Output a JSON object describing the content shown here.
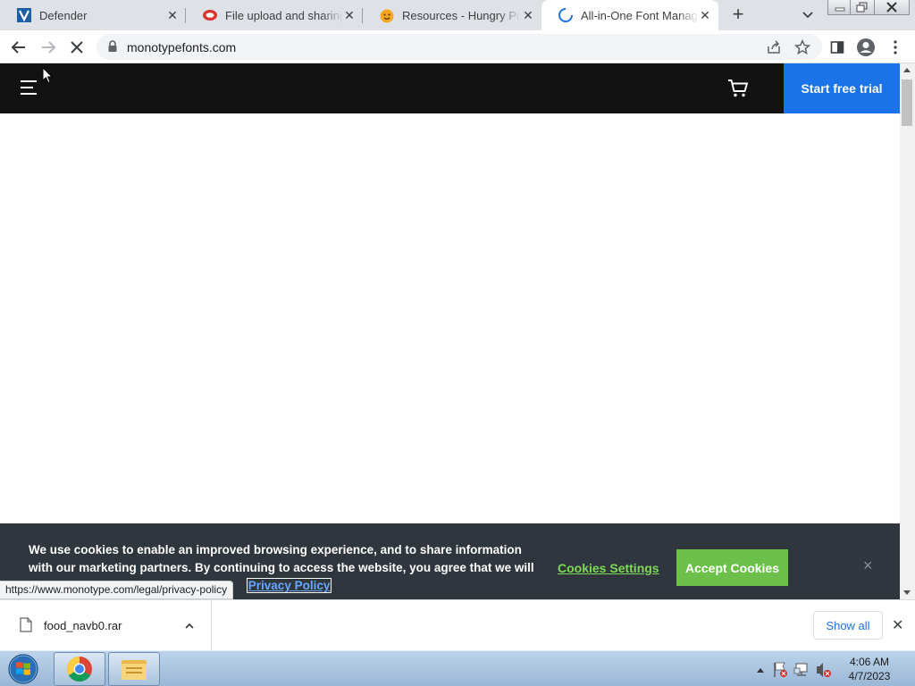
{
  "browser": {
    "tabs": [
      {
        "title": "Defender",
        "icon": "defender-icon",
        "active": false
      },
      {
        "title": "File upload and sharing. I",
        "icon": "file-upload-site-icon",
        "active": false
      },
      {
        "title": "Resources - Hungry Pum",
        "icon": "hungry-pumpkin-icon",
        "active": false
      },
      {
        "title": "All-in-One Font Manager",
        "icon": "loading-spinner-icon",
        "active": true
      }
    ],
    "address": "monotypefonts.com"
  },
  "site_nav": {
    "trial_button": "Start free trial"
  },
  "cookie_banner": {
    "message": "We use cookies to enable an improved browsing experience, and to share information with our marketing partners. By continuing to access the website, you agree that we will store",
    "privacy_link": "Privacy Policy",
    "settings_label": "Cookies Settings",
    "accept_label": "Accept Cookies",
    "close_label": "×"
  },
  "status_bar": {
    "url": "https://www.monotype.com/legal/privacy-policy"
  },
  "downloads": {
    "items": [
      {
        "filename": "food_navb0.rar"
      }
    ],
    "show_all": "Show all"
  },
  "taskbar": {
    "time": "4:06 AM",
    "date": "4/7/2023"
  },
  "colors": {
    "site_nav_bg": "#121212",
    "trial_button": "#1a73e8",
    "cookie_bg": "#30363d",
    "accept_button": "#6cc04a",
    "settings_link": "#7ed957"
  }
}
